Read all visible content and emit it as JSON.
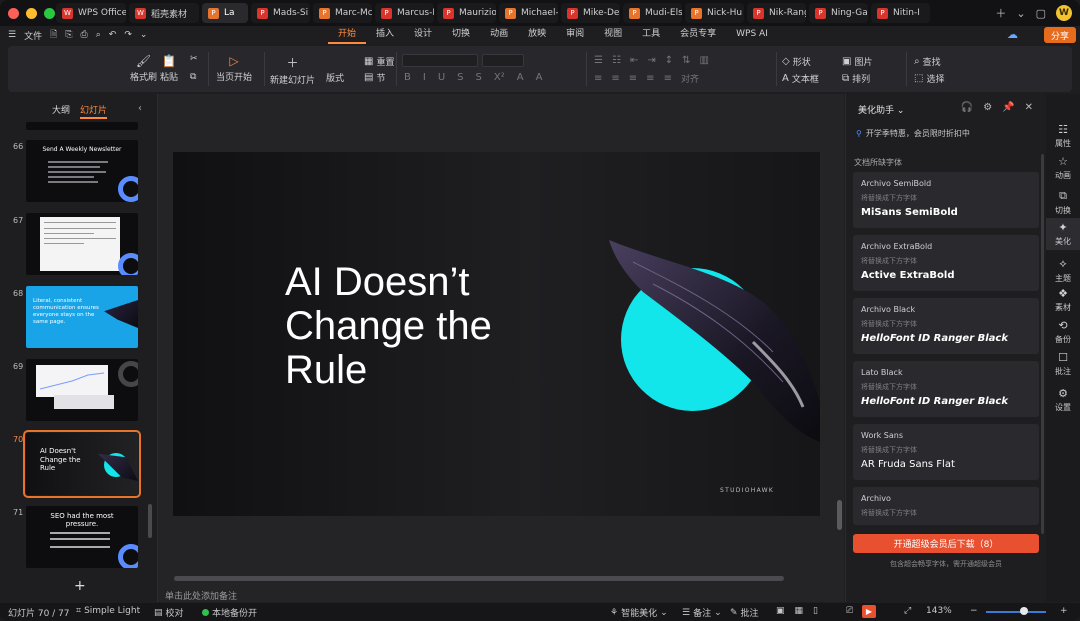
{
  "titlebar": {
    "tabs": [
      {
        "label": "WPS Office",
        "color": "#d9352c",
        "active": false
      },
      {
        "label": "稻壳素材",
        "color": "#d9352c",
        "active": false
      },
      {
        "label": "La",
        "color": "#e8732a",
        "active": true
      },
      {
        "label": "Mads-Si",
        "color": "#d9352c",
        "active": false
      },
      {
        "label": "Marc-Mc",
        "color": "#e8732a",
        "active": false
      },
      {
        "label": "Marcus-I",
        "color": "#d9352c",
        "active": false
      },
      {
        "label": "Maurizio",
        "color": "#d9352c",
        "active": false
      },
      {
        "label": "Michael-",
        "color": "#e8732a",
        "active": false
      },
      {
        "label": "Mike-De",
        "color": "#d9352c",
        "active": false
      },
      {
        "label": "Mudi-Els",
        "color": "#e8732a",
        "active": false
      },
      {
        "label": "Nick-Hu",
        "color": "#e8732a",
        "active": false
      },
      {
        "label": "Nik-Rang",
        "color": "#d9352c",
        "active": false
      },
      {
        "label": "Ning-Ga",
        "color": "#d9352c",
        "active": false
      },
      {
        "label": "Nitin-I",
        "color": "#d9352c",
        "active": false
      }
    ]
  },
  "menu": {
    "file_label": "文件",
    "tabs": [
      "开始",
      "插入",
      "设计",
      "切换",
      "动画",
      "放映",
      "审阅",
      "视图",
      "工具",
      "会员专享",
      "WPS AI"
    ],
    "active_tab": "开始",
    "share_label": "分享"
  },
  "ribbon": {
    "format_painter": "格式刷",
    "paste": "粘贴",
    "from_current": "当页开始",
    "new_slide": "新建幻灯片",
    "layout": "版式",
    "reset": "重置",
    "section": "节",
    "align": "对齐",
    "shape": "形状",
    "picture": "图片",
    "textbox": "文本框",
    "arrange": "排列",
    "find": "查找",
    "select": "选择"
  },
  "left_panel": {
    "tab_outline": "大纲",
    "tab_slides": "幻灯片",
    "thumbs": [
      {
        "num": "66",
        "title": "Send A Weekly Newsletter",
        "type": "bullets"
      },
      {
        "num": "67",
        "title": "",
        "type": "doc"
      },
      {
        "num": "68",
        "title": "Literal, consistent communication ensures everyone stays on the same page.",
        "type": "blue"
      },
      {
        "num": "69",
        "title": "",
        "type": "chart"
      },
      {
        "num": "70",
        "title": "AI Doesn't Change the Rule",
        "type": "selected"
      },
      {
        "num": "71",
        "title": "SEO had the most pressure.",
        "type": "seo"
      }
    ],
    "add_slide": "+"
  },
  "slide": {
    "title": "AI Doesn’t Change the Rule",
    "logo": "STUDIOHAWK"
  },
  "editor": {
    "notes_placeholder": "单击此处添加备注"
  },
  "right_panel": {
    "title": "美化助手",
    "promo": "开学季特惠，会员限时折扣中",
    "section": "文档所缺字体",
    "hint": "将替换成下方字体",
    "fonts": [
      {
        "name": "Archivo SemiBold",
        "replacement": "MiSans SemiBold"
      },
      {
        "name": "Archivo ExtraBold",
        "replacement": "Active ExtraBold"
      },
      {
        "name": "Archivo Black",
        "replacement": "HelloFont ID Ranger Black"
      },
      {
        "name": "Lato Black",
        "replacement": "HelloFont ID Ranger Black"
      },
      {
        "name": "Work Sans",
        "replacement": "AR Fruda Sans Flat"
      },
      {
        "name": "Archivo",
        "replacement": ""
      }
    ],
    "cta": "开通超级会员后下载（8）",
    "cta_sub": "包含超会畅享字体，需开通超级会员"
  },
  "sidebar": {
    "items": [
      "属性",
      "动画",
      "切换",
      "美化",
      "主题",
      "素材",
      "备份",
      "批注",
      "设置"
    ],
    "active": "美化"
  },
  "status": {
    "slide_counter": "幻灯片 70 / 77",
    "theme": "Simple Light",
    "proofread": "校对",
    "backup": "本地备份开",
    "beautify": "智能美化",
    "notes": "备注",
    "comments": "批注",
    "zoom": "143%"
  }
}
